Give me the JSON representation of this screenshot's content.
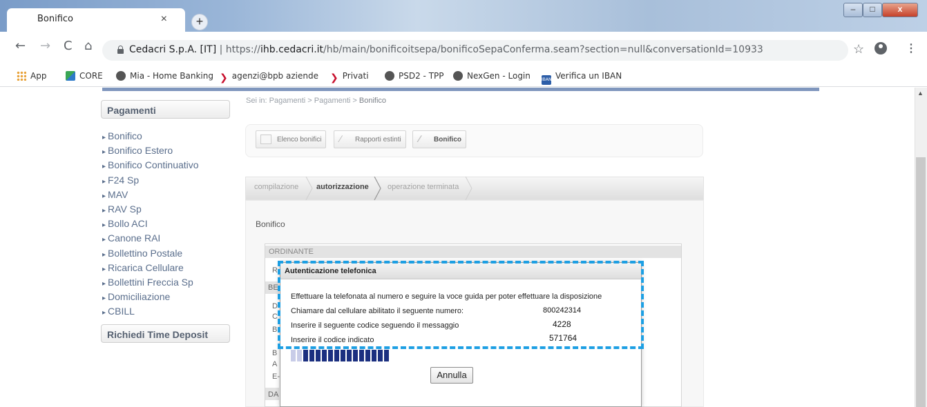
{
  "browser": {
    "tab_title": "Bonifico",
    "tab_close": "×",
    "new_tab": "+",
    "window_controls": {
      "minimize": "–",
      "maximize": "□",
      "close": "x"
    },
    "nav": {
      "back": "←",
      "forward": "→",
      "reload": "C",
      "home": "⌂"
    },
    "address": {
      "site_label": "Cedacri S.p.A. [IT]",
      "separator": "|",
      "url_prefix": "https://",
      "url_domain": "ihb.cedacri.it",
      "url_path": "/hb/main/bonificoitsepa/bonificoSepaConferma.seam?section=null&conversationId=10933"
    },
    "icons": {
      "star": "☆",
      "menu": "⋮"
    },
    "bookmarks": [
      {
        "label": "App",
        "icon": "apps-icon"
      },
      {
        "label": "CORE",
        "icon": "core-icon"
      },
      {
        "label": "Mia - Home Banking",
        "icon": "globe-icon"
      },
      {
        "label": "agenzi@bpb aziende",
        "icon": "bpb-icon"
      },
      {
        "label": "Privati",
        "icon": "bpb-icon"
      },
      {
        "label": "PSD2 - TPP",
        "icon": "globe-icon"
      },
      {
        "label": "NexGen - Login",
        "icon": "globe-icon"
      },
      {
        "label": "Verifica un IBAN",
        "icon": "iban-icon"
      }
    ],
    "bookmark_glyphs": {
      "bpb": "❯",
      "iban": "IBAN"
    }
  },
  "sidebar": {
    "heading": "Pagamenti",
    "items": [
      "Bonifico",
      "Bonifico Estero",
      "Bonifico Continuativo",
      "F24 Sp",
      "MAV",
      "RAV Sp",
      "Bollo ACI",
      "Canone RAI",
      "Bollettino Postale",
      "Ricarica Cellulare",
      "Bollettini Freccia Sp",
      "Domiciliazione",
      "CBILL"
    ],
    "heading2": "Richiedi Time Deposit"
  },
  "breadcrumb": {
    "prefix": "Sei in: Pagamenti > Pagamenti > ",
    "current": "Bonifico"
  },
  "toolbar": {
    "elenco": "Elenco bonifici",
    "rapporti": "Rapporti estinti",
    "bonifico": "Bonifico",
    "pen_glyph": "∕"
  },
  "steps": [
    "compilazione",
    "autorizzazione",
    "operazione terminata"
  ],
  "section_title": "Bonifico",
  "form": {
    "ordinante": "ORDINANTE",
    "partial_letters": [
      "R",
      "BE",
      "D",
      "C",
      "B",
      "B",
      "A",
      "E-",
      "DA"
    ]
  },
  "modal": {
    "title": "Autenticazione telefonica",
    "instruction": "Effettuare la telefonata al numero e seguire la voce guida per poter effettuare la disposizione",
    "call_label": "Chiamare dal cellulare abilitato il seguente numero:",
    "call_number": "800242314",
    "code_label": "Inserire il seguente codice seguendo il messaggio",
    "code_value": "4228",
    "indicated_label": "Inserire il codice indicato",
    "indicated_value": "571764",
    "progress": {
      "filled": 14,
      "empty": 2
    },
    "cancel_label": "Annulla"
  },
  "colors": {
    "highlight": "#1d9fe3",
    "progress": "#1b2f80",
    "topbar": "#7f96bd"
  }
}
